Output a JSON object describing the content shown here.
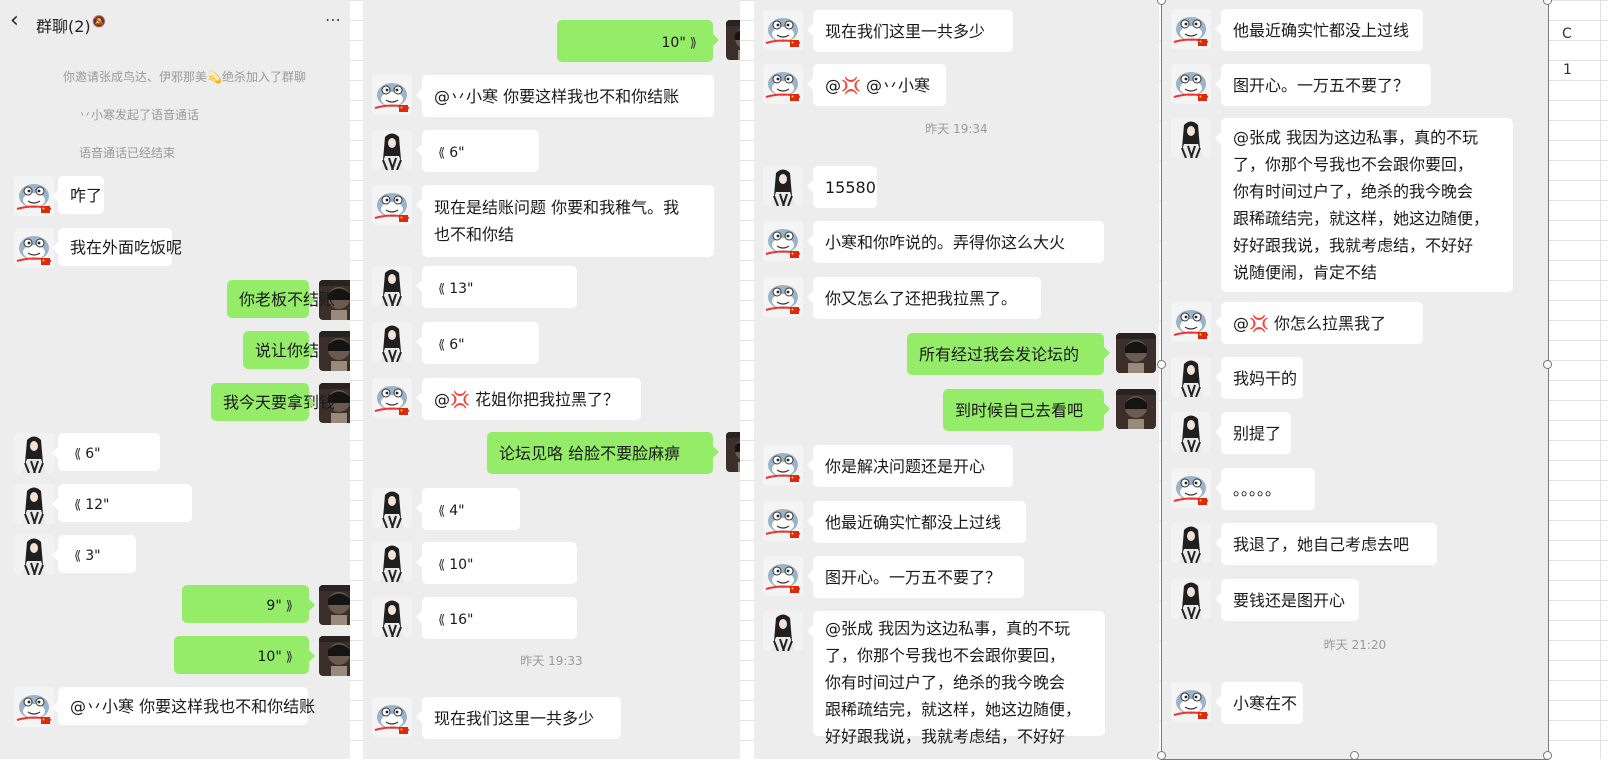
{
  "header": {
    "title": "群聊(2)"
  },
  "colors": {
    "panel_bg": "#ededed",
    "incoming": "#ffffff",
    "outgoing": "#95ec69",
    "system_text": "#9a9a9a"
  },
  "icons": {
    "back": "chevron-left-icon",
    "mute": "bell-off-icon",
    "more": "more-icon",
    "voice": "voice-wave-icon"
  },
  "edge_text": [
    "C",
    "1"
  ],
  "panels": [
    {
      "system": [
        "你邀请张成鸟达、伊邪那美💫绝杀加入了群聊",
        "丷小寒发起了语音通话",
        "语音通话已经结束"
      ],
      "messages": [
        {
          "who": "blue",
          "type": "text",
          "text": "咋了"
        },
        {
          "who": "blue",
          "type": "text",
          "text": "我在外面吃饭呢"
        },
        {
          "who": "me",
          "type": "text",
          "text": "你老板不结账"
        },
        {
          "who": "me",
          "type": "text",
          "text": "说让你结"
        },
        {
          "who": "me",
          "type": "text",
          "text": "我今天要拿到钱"
        },
        {
          "who": "girl",
          "type": "voice",
          "text": "6\""
        },
        {
          "who": "girl",
          "type": "voice",
          "text": "12\""
        },
        {
          "who": "girl",
          "type": "voice",
          "text": "3\""
        },
        {
          "who": "me",
          "type": "voice",
          "text": "9\""
        },
        {
          "who": "me",
          "type": "voice",
          "text": "10\""
        },
        {
          "who": "blue",
          "type": "text",
          "text": "@丷小寒 你要这样我也不和你结账"
        }
      ]
    },
    {
      "timestamp": "昨天 19:33",
      "messages": [
        {
          "who": "me",
          "type": "voice",
          "text": "10\""
        },
        {
          "who": "blue",
          "type": "text",
          "text": "@丷小寒 你要这样我也不和你结账"
        },
        {
          "who": "girl",
          "type": "voice",
          "text": "6\""
        },
        {
          "who": "blue",
          "type": "text",
          "lines": [
            "现在是结账问题 你要和我稚气。我",
            "也不和你结"
          ]
        },
        {
          "who": "girl",
          "type": "voice",
          "text": "13\""
        },
        {
          "who": "girl",
          "type": "voice",
          "text": "6\""
        },
        {
          "who": "blue",
          "type": "text",
          "text": "@💢 花姐你把我拉黑了？"
        },
        {
          "who": "me",
          "type": "text",
          "text": "论坛见咯  给脸不要脸麻痹"
        },
        {
          "who": "girl",
          "type": "voice",
          "text": "4\""
        },
        {
          "who": "girl",
          "type": "voice",
          "text": "10\""
        },
        {
          "who": "girl",
          "type": "voice",
          "text": "16\""
        },
        {
          "who": "blue",
          "type": "text",
          "text": "现在我们这里一共多少"
        }
      ]
    },
    {
      "timestamp": "昨天 19:34",
      "messages": [
        {
          "who": "blue",
          "type": "text",
          "text": "现在我们这里一共多少"
        },
        {
          "who": "blue",
          "type": "text",
          "text": "@💢 @丷小寒"
        },
        {
          "who": "girl",
          "type": "text",
          "text": "15580"
        },
        {
          "who": "blue",
          "type": "text",
          "text": "小寒和你咋说的。弄得你这么大火"
        },
        {
          "who": "blue",
          "type": "text",
          "text": "你又怎么了还把我拉黑了。"
        },
        {
          "who": "me",
          "type": "text",
          "text": "所有经过我会发论坛的"
        },
        {
          "who": "me",
          "type": "text",
          "text": "到时候自己去看吧"
        },
        {
          "who": "blue",
          "type": "text",
          "text": "你是解决问题还是开心"
        },
        {
          "who": "blue",
          "type": "text",
          "text": "他最近确实忙都没上过线"
        },
        {
          "who": "blue",
          "type": "text",
          "text": "图开心。一万五不要了？"
        },
        {
          "who": "girl",
          "type": "text",
          "lines": [
            "@张成  我因为这边私事，真的不玩",
            "了，你那个号我也不会跟你要回，",
            "你有时间过户了，绝杀的我今晚会",
            "跟稀疏结完，就这样，她这边随便，",
            "好好跟我说，我就考虑结，不好好"
          ]
        }
      ]
    },
    {
      "timestamp": "昨天 21:20",
      "messages": [
        {
          "who": "blue",
          "type": "text",
          "text": "他最近确实忙都没上过线"
        },
        {
          "who": "blue",
          "type": "text",
          "text": "图开心。一万五不要了？"
        },
        {
          "who": "girl",
          "type": "text",
          "lines": [
            "@张成  我因为这边私事，真的不玩",
            "了，你那个号我也不会跟你要回，",
            "你有时间过户了，绝杀的我今晚会",
            "跟稀疏结完，就这样，她这边随便，",
            "好好跟我说，我就考虑结，不好好",
            "说随便闹，肯定不结"
          ]
        },
        {
          "who": "blue",
          "type": "text",
          "text": "@💢  你怎么拉黑我了"
        },
        {
          "who": "girl",
          "type": "text",
          "text": "我妈干的"
        },
        {
          "who": "girl",
          "type": "text",
          "text": "别提了"
        },
        {
          "who": "blue",
          "type": "text",
          "text": "。。。。。"
        },
        {
          "who": "girl",
          "type": "text",
          "text": "我退了，她自己考虑去吧"
        },
        {
          "who": "girl",
          "type": "text",
          "text": "要钱还是图开心"
        },
        {
          "who": "blue",
          "type": "text",
          "text": "小寒在不"
        }
      ]
    }
  ]
}
